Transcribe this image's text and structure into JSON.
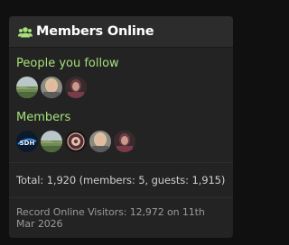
{
  "widget": {
    "title": "Members Online",
    "icon": "users-icon",
    "accent_color": "#a6e07a"
  },
  "following": {
    "title": "People you follow",
    "avatars": [
      "avatar-landscape",
      "avatar-person-blonde",
      "avatar-person-dark"
    ]
  },
  "members": {
    "title": "Members",
    "avatars": [
      "avatar-sdh-logo",
      "avatar-landscape",
      "avatar-emblem",
      "avatar-person-blonde",
      "avatar-person-dark"
    ]
  },
  "stats": {
    "total": "Total: 1,920 (members: 5, guests: 1,915)",
    "record": "Record Online Visitors: 12,972 on 11th Mar 2026"
  }
}
